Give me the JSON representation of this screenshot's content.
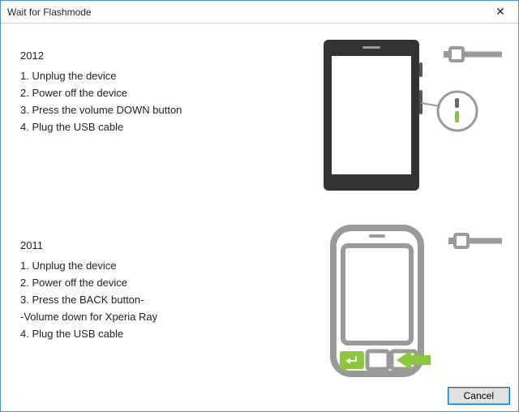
{
  "window": {
    "title": "Wait for Flashmode",
    "close_label": "✕",
    "cancel_label": "Cancel"
  },
  "sections": {
    "s2012": {
      "year": "2012",
      "steps": [
        "1.  Unplug the device",
        "2.  Power off the device",
        "3.  Press the volume DOWN button",
        "4.  Plug the USB cable"
      ]
    },
    "s2011": {
      "year": "2011",
      "steps": [
        "1.  Unplug the device",
        "2.  Power off the device",
        "3.  Press the BACK button-",
        "-Volume down for Xperia Ray",
        "4.  Plug the USB cable"
      ]
    }
  }
}
